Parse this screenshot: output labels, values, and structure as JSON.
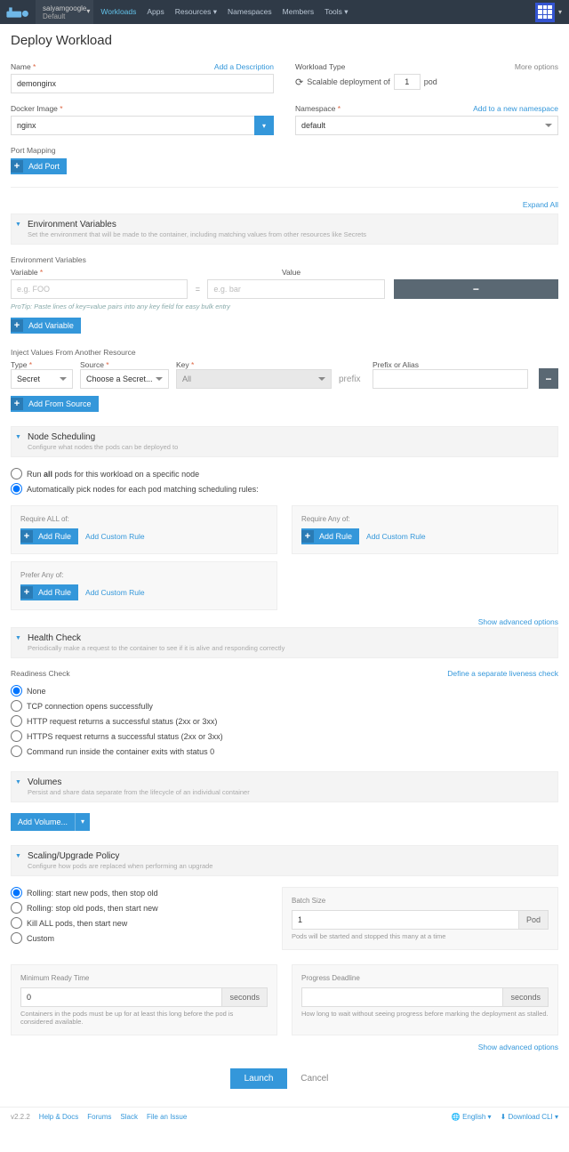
{
  "topbar": {
    "cluster_name": "saiyamgoogle",
    "cluster_ns": "Default",
    "nav": [
      "Workloads",
      "Apps",
      "Resources",
      "Namespaces",
      "Members",
      "Tools"
    ]
  },
  "page_title": "Deploy Workload",
  "name": {
    "label": "Name",
    "add_desc": "Add a Description",
    "value": "demonginx"
  },
  "workload_type": {
    "label": "Workload Type",
    "more": "More options",
    "text_before": "Scalable deployment of",
    "count": "1",
    "text_after": "pod"
  },
  "docker": {
    "label": "Docker Image",
    "value": "nginx"
  },
  "namespace": {
    "label": "Namespace",
    "add_new": "Add to a new namespace",
    "value": "default"
  },
  "port_mapping": {
    "label": "Port Mapping",
    "btn": "Add Port"
  },
  "expand_all": "Expand All",
  "env": {
    "title": "Environment Variables",
    "desc": "Set the environment that will be made to the container, including matching values from other resources like Secrets",
    "sub": "Environment Variables",
    "var_label": "Variable",
    "var_ph": "e.g. FOO",
    "val_label": "Value",
    "val_ph": "e.g. bar",
    "hint": "ProTip: Paste lines of key=value pairs into any key field for easy bulk entry",
    "add_var": "Add Variable",
    "inject": {
      "title": "Inject Values From Another Resource",
      "type": "Type",
      "type_val": "Secret",
      "source": "Source",
      "source_val": "Choose a Secret...",
      "key": "Key",
      "key_val": "All",
      "prefix": "Prefix or Alias",
      "prefix_ph": "prefix",
      "btn": "Add From Source"
    }
  },
  "sched": {
    "title": "Node Scheduling",
    "desc": "Configure what nodes the pods can be deployed to",
    "r1a": "Run ",
    "r1b": "all",
    "r1c": " pods for this workload on a specific node",
    "r2": "Automatically pick nodes for each pod matching scheduling rules:",
    "req_all": "Require ALL of:",
    "req_any": "Require Any of:",
    "pref_any": "Prefer Any of:",
    "add_rule": "Add Rule",
    "add_custom": "Add Custom Rule",
    "show_adv": "Show advanced options"
  },
  "health": {
    "title": "Health Check",
    "desc": "Periodically make a request to the container to see if it is alive and responding correctly",
    "readiness": "Readiness Check",
    "liveness_link": "Define a separate liveness check",
    "opts": [
      "None",
      "TCP connection opens successfully",
      "HTTP request returns a successful status (2xx or 3xx)",
      "HTTPS request returns a successful status (2xx or 3xx)",
      "Command run inside the container exits with status 0"
    ]
  },
  "volumes": {
    "title": "Volumes",
    "desc": "Persist and share data separate from the lifecycle of an individual container",
    "btn": "Add Volume..."
  },
  "scaling": {
    "title": "Scaling/Upgrade Policy",
    "desc": "Configure how pods are replaced when performing an upgrade",
    "opts": [
      "Rolling: start new pods, then stop old",
      "Rolling: stop old pods, then start new",
      "Kill ALL pods, then start new",
      "Custom"
    ],
    "batch": {
      "label": "Batch Size",
      "val": "1",
      "suffix": "Pod",
      "help": "Pods will be started and stopped this many at a time"
    },
    "min_ready": {
      "label": "Minimum Ready Time",
      "val": "0",
      "suffix": "seconds",
      "help": "Containers in the pods must be up for at least this long before the pod is considered available."
    },
    "deadline": {
      "label": "Progress Deadline",
      "suffix": "seconds",
      "help": "How long to wait without seeing progress before marking the deployment as stalled."
    },
    "show_adv": "Show advanced options"
  },
  "launch": "Launch",
  "cancel": "Cancel",
  "footer": {
    "version": "v2.2.2",
    "links": [
      "Help & Docs",
      "Forums",
      "Slack",
      "File an Issue"
    ],
    "lang": "English",
    "dl": "Download CLI"
  }
}
